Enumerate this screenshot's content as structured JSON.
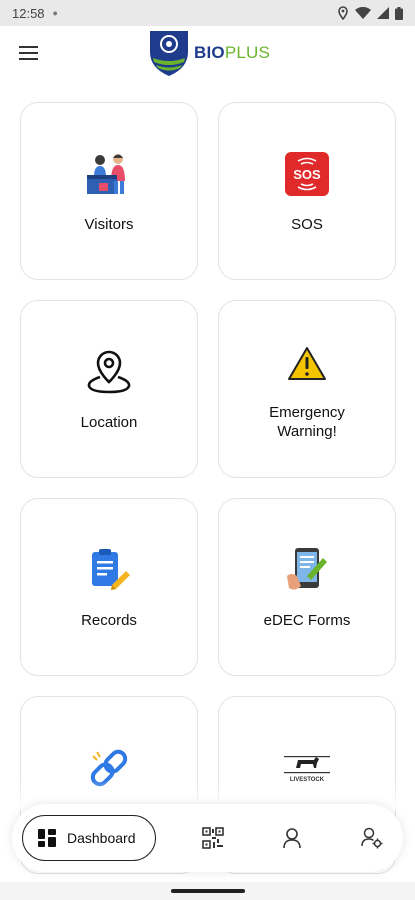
{
  "status_bar": {
    "time": "12:58"
  },
  "header": {
    "logo_bio": "BIO",
    "logo_plus": "PLUS"
  },
  "tiles": [
    {
      "label": "Visitors",
      "icon": "visitors-icon"
    },
    {
      "label": "SOS",
      "icon": "sos-icon"
    },
    {
      "label": "Location",
      "icon": "location-pin-icon"
    },
    {
      "label": "Emergency\nWarning!",
      "icon": "warning-icon"
    },
    {
      "label": "Records",
      "icon": "records-clipboard-icon"
    },
    {
      "label": "eDEC Forms",
      "icon": "edec-forms-icon"
    },
    {
      "label": "",
      "icon": "link-icon"
    },
    {
      "label": "",
      "icon": "livestock-icon"
    }
  ],
  "sos_badge_text": "SOS",
  "livestock_logo_text": "LIVESTOCK",
  "bottom_nav": {
    "dashboard_label": "Dashboard",
    "items": [
      "qr-code-icon",
      "user-icon",
      "user-settings-icon"
    ]
  },
  "colors": {
    "brand_blue": "#1f3c8c",
    "brand_green": "#6ab42d",
    "sos_red": "#e02a2a",
    "warning_yellow": "#f5c400"
  }
}
